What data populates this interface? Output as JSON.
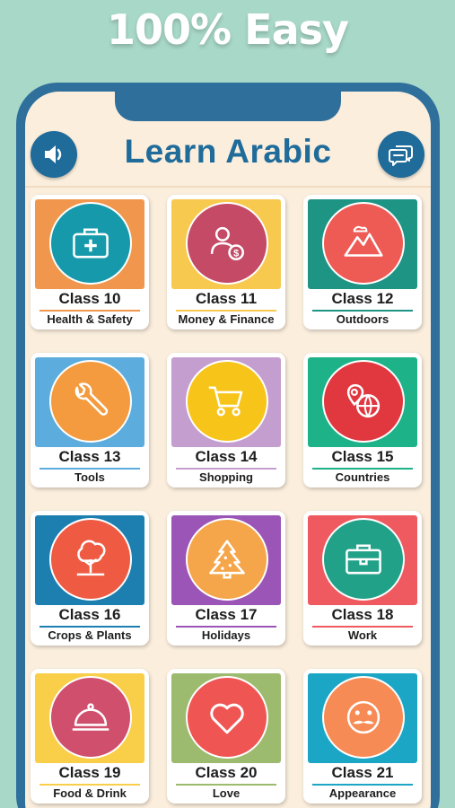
{
  "promo": {
    "headline": "100% Easy"
  },
  "header": {
    "title": "Learn Arabic",
    "sound_icon": "speaker-icon",
    "chat_icon": "chat-bubbles-icon"
  },
  "colors": {
    "background": "#a8d8c8",
    "phone_frame": "#2f6f9b",
    "screen": "#fbeedd",
    "title": "#1f6b9a"
  },
  "classes": [
    {
      "class_label": "Class 10",
      "topic": "Health & Safety",
      "icon": "first-aid-kit-icon",
      "tile_color": "#f0974d",
      "circle_color": "#169aab",
      "bar_color": "#f0974d"
    },
    {
      "class_label": "Class 11",
      "topic": "Money & Finance",
      "icon": "person-money-icon",
      "tile_color": "#f7c94f",
      "circle_color": "#c44a66",
      "bar_color": "#f7c94f"
    },
    {
      "class_label": "Class 12",
      "topic": "Outdoors",
      "icon": "mountain-icon",
      "tile_color": "#1e9485",
      "circle_color": "#ee5a54",
      "bar_color": "#1e9485"
    },
    {
      "class_label": "Class 13",
      "topic": "Tools",
      "icon": "wrench-icon",
      "tile_color": "#5cacdd",
      "circle_color": "#f39b3e",
      "bar_color": "#5cacdd"
    },
    {
      "class_label": "Class 14",
      "topic": "Shopping",
      "icon": "shopping-cart-icon",
      "tile_color": "#c59ed0",
      "circle_color": "#f7c41a",
      "bar_color": "#c59ed0"
    },
    {
      "class_label": "Class 15",
      "topic": "Countries",
      "icon": "globe-pin-icon",
      "tile_color": "#1db288",
      "circle_color": "#e1373f",
      "bar_color": "#1db288"
    },
    {
      "class_label": "Class 16",
      "topic": "Crops & Plants",
      "icon": "tree-icon",
      "tile_color": "#1c7fb0",
      "circle_color": "#ef5a43",
      "bar_color": "#1c7fb0"
    },
    {
      "class_label": "Class 17",
      "topic": "Holidays",
      "icon": "christmas-tree-icon",
      "tile_color": "#9a55b7",
      "circle_color": "#f5a64a",
      "bar_color": "#9a55b7"
    },
    {
      "class_label": "Class 18",
      "topic": "Work",
      "icon": "briefcase-icon",
      "tile_color": "#ee5a5f",
      "circle_color": "#22a189",
      "bar_color": "#ee5a5f"
    },
    {
      "class_label": "Class 19",
      "topic": "Food & Drink",
      "icon": "cloche-icon",
      "tile_color": "#f9cf4a",
      "circle_color": "#cf4f6d",
      "bar_color": "#f9cf4a"
    },
    {
      "class_label": "Class 20",
      "topic": "Love",
      "icon": "heart-icon",
      "tile_color": "#9dbb6e",
      "circle_color": "#ef5553",
      "bar_color": "#9dbb6e"
    },
    {
      "class_label": "Class 21",
      "topic": "Appearance",
      "icon": "mustache-face-icon",
      "tile_color": "#1ca6c6",
      "circle_color": "#f78b55",
      "bar_color": "#1ca6c6"
    }
  ]
}
